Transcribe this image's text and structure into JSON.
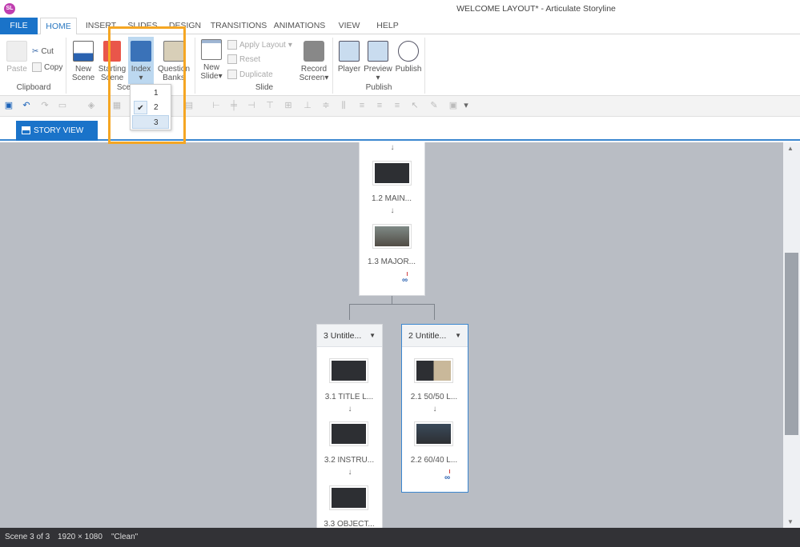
{
  "window": {
    "title": "WELCOME LAYOUT* -  Articulate Storyline",
    "logo": "SL"
  },
  "tabs": [
    "FILE",
    "HOME",
    "INSERT",
    "SLIDES",
    "DESIGN",
    "TRANSITIONS",
    "ANIMATIONS",
    "VIEW",
    "HELP"
  ],
  "ribbon": {
    "clipboard": {
      "paste": "Paste",
      "cut": "Cut",
      "copy": "Copy",
      "group": "Clipboard"
    },
    "scene": {
      "new_scene": [
        "New",
        "Scene"
      ],
      "starting_scene": [
        "Starting",
        "Scene"
      ],
      "index": "Index",
      "question_banks": [
        "Question",
        "Banks"
      ],
      "group": "Scene"
    },
    "slide": {
      "new_slide": [
        "New",
        "Slide"
      ],
      "apply_layout": "Apply Layout",
      "reset": "Reset",
      "duplicate": "Duplicate",
      "record_screen": [
        "Record",
        "Screen"
      ],
      "group": "Slide"
    },
    "publish": {
      "player": "Player",
      "preview": "Preview",
      "publish": "Publish",
      "group": "Publish"
    }
  },
  "index_menu": {
    "items": [
      "1",
      "2",
      "3"
    ],
    "checked": "2",
    "hovered": "3"
  },
  "view_tab": "STORY VIEW",
  "scenes": [
    {
      "slides": [
        {
          "label": "1.2  MAIN..."
        },
        {
          "label": "1.3  MAJOR..."
        }
      ]
    },
    {
      "title": "3  Untitle...",
      "slides": [
        {
          "label": "3.1  TITLE L..."
        },
        {
          "label": "3.2  INSTRU..."
        },
        {
          "label": "3.3  OBJECT..."
        }
      ]
    },
    {
      "title": "2  Untitle...",
      "slides": [
        {
          "label": "2.1  50/50 L..."
        },
        {
          "label": "2.2  60/40 L..."
        }
      ]
    }
  ],
  "status": {
    "scene": "Scene 3 of 3",
    "resolution": "1920 × 1080",
    "theme": "\"Clean\""
  },
  "colors": {
    "accent": "#1a73c9",
    "highlight": "#f5a623",
    "canvas": "#b9bdc4"
  }
}
